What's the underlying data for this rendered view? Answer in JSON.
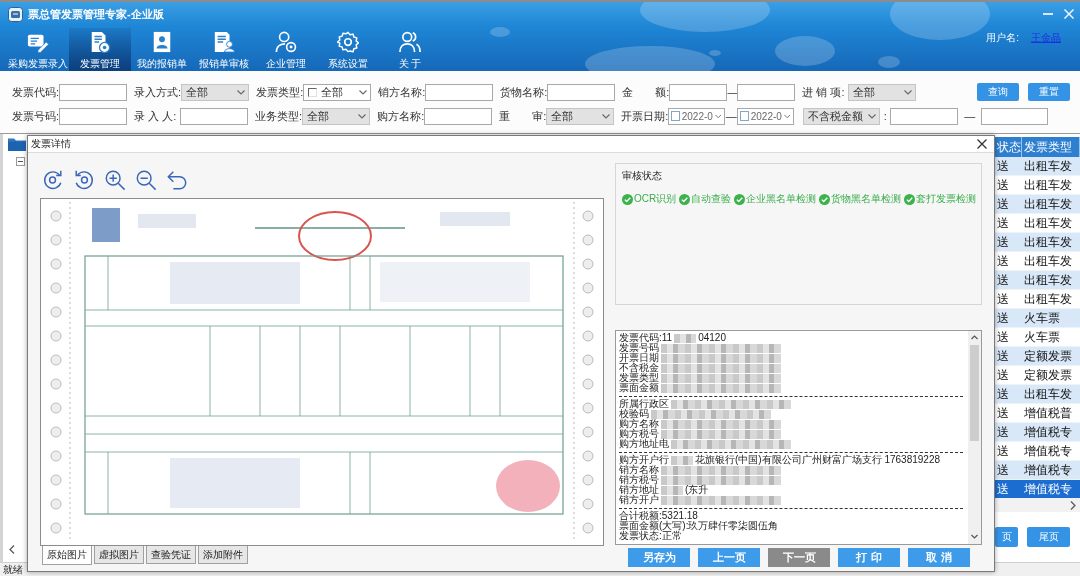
{
  "window": {
    "title": "票总管发票管理专家-企业版",
    "user_label": "用户名:",
    "user_name": "王金晶"
  },
  "toolbar": [
    {
      "label": "采购发票录入",
      "selected": false
    },
    {
      "label": "发票管理",
      "selected": true
    },
    {
      "label": "我的报销单",
      "selected": false
    },
    {
      "label": "报销单审核",
      "selected": false
    },
    {
      "label": "企业管理",
      "selected": false
    },
    {
      "label": "系统设置",
      "selected": false
    },
    {
      "label": "关 于",
      "selected": false
    }
  ],
  "filters": {
    "rows": [
      [
        {
          "kind": "input",
          "label": "发票代码:"
        },
        {
          "kind": "select",
          "label": "录入方式:",
          "value": "全部"
        },
        {
          "kind": "checkselect",
          "label": "发票类型:",
          "value": "全部",
          "checked": false
        },
        {
          "kind": "input",
          "label": "销方名称:"
        },
        {
          "kind": "input",
          "label": "货物名称:"
        },
        {
          "kind": "range",
          "label": "金　　额:",
          "separator": "—"
        },
        {
          "kind": "select",
          "label": "进 销 项:",
          "value": "全部"
        }
      ],
      [
        {
          "kind": "input",
          "label": "发票号码:"
        },
        {
          "kind": "input",
          "label": "录 入 人:"
        },
        {
          "kind": "select",
          "label": "业务类型:",
          "value": "全部"
        },
        {
          "kind": "input",
          "label": "购方名称:"
        },
        {
          "kind": "select",
          "label": "重　　审:",
          "value": "全部"
        },
        {
          "kind": "daterange",
          "label": "开票日期:",
          "separator": "—",
          "from": {
            "value": "2022-0",
            "checked": false
          },
          "to": {
            "value": "2022-0",
            "checked": false
          }
        },
        {
          "kind": "selectrange",
          "value": "不含税金额",
          "colon": ":",
          "separator": "—"
        }
      ]
    ],
    "buttons": [
      "查询",
      "重置"
    ]
  },
  "table": {
    "columns": [
      "状态",
      "发票类型"
    ],
    "rows": [
      {
        "cells": [
          "送",
          "出租车发"
        ],
        "selected": false
      },
      {
        "cells": [
          "送",
          "出租车发"
        ],
        "selected": false
      },
      {
        "cells": [
          "送",
          "出租车发"
        ],
        "selected": false
      },
      {
        "cells": [
          "送",
          "出租车发"
        ],
        "selected": false
      },
      {
        "cells": [
          "送",
          "出租车发"
        ],
        "selected": false
      },
      {
        "cells": [
          "送",
          "出租车发"
        ],
        "selected": false
      },
      {
        "cells": [
          "送",
          "出租车发"
        ],
        "selected": false
      },
      {
        "cells": [
          "送",
          "出租车发"
        ],
        "selected": false
      },
      {
        "cells": [
          "送",
          "火车票"
        ],
        "selected": false
      },
      {
        "cells": [
          "送",
          "火车票"
        ],
        "selected": false
      },
      {
        "cells": [
          "送",
          "定额发票"
        ],
        "selected": false
      },
      {
        "cells": [
          "送",
          "定额发票"
        ],
        "selected": false
      },
      {
        "cells": [
          "送",
          "出租车发"
        ],
        "selected": false
      },
      {
        "cells": [
          "送",
          "增值税普"
        ],
        "selected": false
      },
      {
        "cells": [
          "送",
          "增值税专"
        ],
        "selected": false
      },
      {
        "cells": [
          "送",
          "增值税专"
        ],
        "selected": false
      },
      {
        "cells": [
          "送",
          "增值税专"
        ],
        "selected": false
      },
      {
        "cells": [
          "送",
          "增值税专"
        ],
        "selected": true
      }
    ],
    "pager": [
      "页",
      "尾页"
    ]
  },
  "dialog": {
    "title": "发票详情",
    "tabs": [
      {
        "label": "原始图片",
        "selected": true
      },
      {
        "label": "虚拟图片",
        "selected": false
      },
      {
        "label": "查验凭证",
        "selected": false
      },
      {
        "label": "添加附件",
        "selected": false
      }
    ],
    "audit": {
      "title": "审核状态",
      "checks": [
        {
          "label": "OCR识别",
          "passed": true
        },
        {
          "label": "自动查验",
          "passed": true
        },
        {
          "label": "企业黑名单检测",
          "passed": true
        },
        {
          "label": "货物黑名单检测",
          "passed": true
        },
        {
          "label": "套打发票检测",
          "passed": true
        }
      ]
    },
    "details": {
      "sections": [
        [
          {
            "label": "发票代码:11",
            "redacted": true,
            "value": "04120"
          },
          {
            "label": "发票号码",
            "redacted": true
          },
          {
            "label": "开票日期",
            "redacted": true
          },
          {
            "label": "不含税金",
            "redacted": true
          },
          {
            "label": "发票类型",
            "redacted": true
          },
          {
            "label": "票面金额",
            "redacted": true
          }
        ],
        [
          {
            "label": "所属行政区",
            "redacted": true
          },
          {
            "label": "校验码",
            "redacted": true
          },
          {
            "label": "购方名称",
            "redacted": true
          },
          {
            "label": "购方税号",
            "redacted": true
          },
          {
            "label": "购方地址电",
            "redacted": true
          }
        ],
        [
          {
            "label": "购方开户行",
            "redacted": true,
            "value": "花旗银行(中国)有限公司广州财富广场支行 1763819228"
          },
          {
            "label": "销方名称",
            "redacted": true
          },
          {
            "label": "销方税号",
            "redacted": true
          },
          {
            "label": "销方地址",
            "redacted": true,
            "value": "(东升"
          },
          {
            "label": "销方开户",
            "redacted": true
          }
        ],
        [
          {
            "label": "合计税额:5321.18",
            "redacted": false
          },
          {
            "label": "票面金额(大写):玖万肆仟零柒圆伍角",
            "redacted": false
          },
          {
            "label": "发票状态:正常",
            "redacted": false
          }
        ]
      ]
    },
    "buttons": [
      {
        "label": "另存为",
        "disabled": false
      },
      {
        "label": "上一页",
        "disabled": false
      },
      {
        "label": "下一页",
        "disabled": true
      },
      {
        "label": "打 印",
        "disabled": false
      },
      {
        "label": "取 消",
        "disabled": false
      }
    ]
  },
  "status_bar": {
    "text": "就绪"
  }
}
